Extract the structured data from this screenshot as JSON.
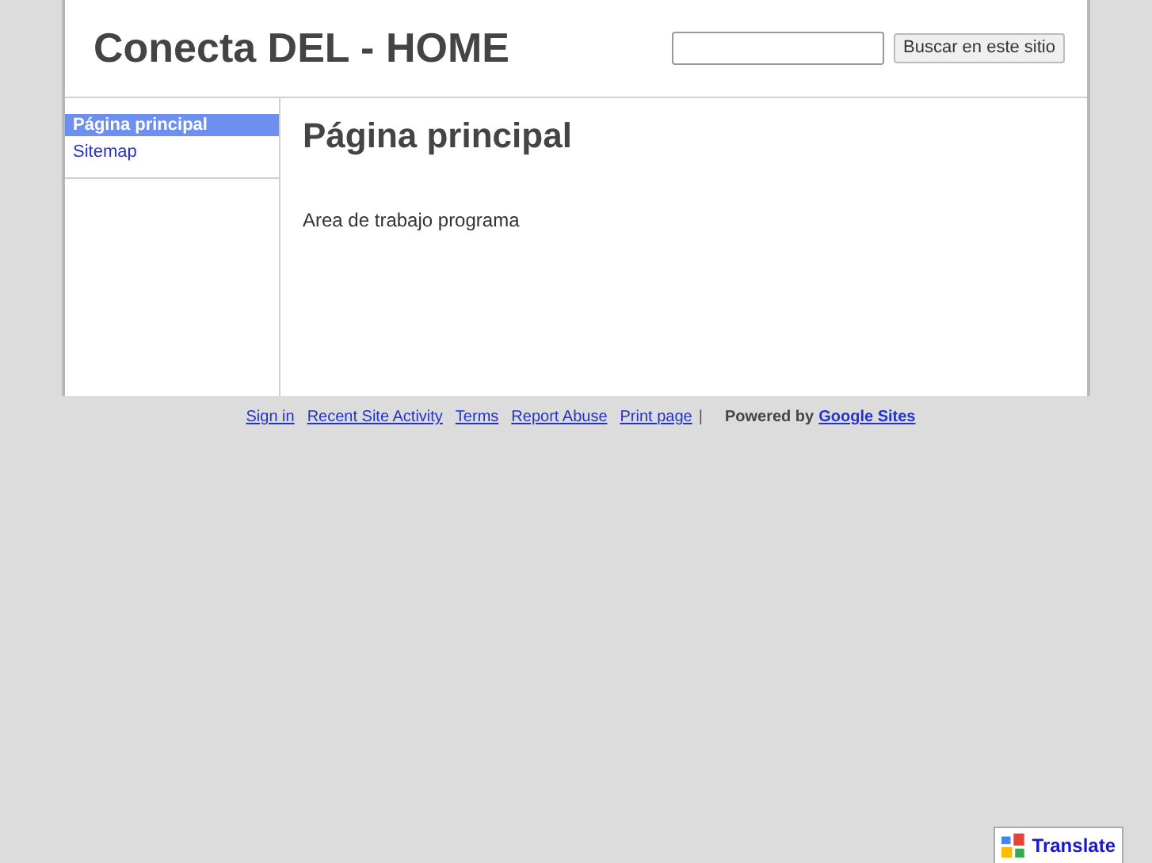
{
  "header": {
    "title": "Conecta DEL - HOME",
    "search_button": "Buscar en este sitio"
  },
  "sidebar": {
    "items": [
      {
        "label": "Página principal",
        "selected": true
      },
      {
        "label": "Sitemap",
        "selected": false
      }
    ]
  },
  "content": {
    "heading": "Página principal",
    "body": "Area de trabajo programa"
  },
  "footer": {
    "links": [
      "Sign in",
      "Recent Site Activity",
      "Terms",
      "Report Abuse",
      "Print page"
    ],
    "separator": "|",
    "powered_by": "Powered by",
    "brand_link": "Google Sites"
  },
  "translate_button": "Translate"
}
